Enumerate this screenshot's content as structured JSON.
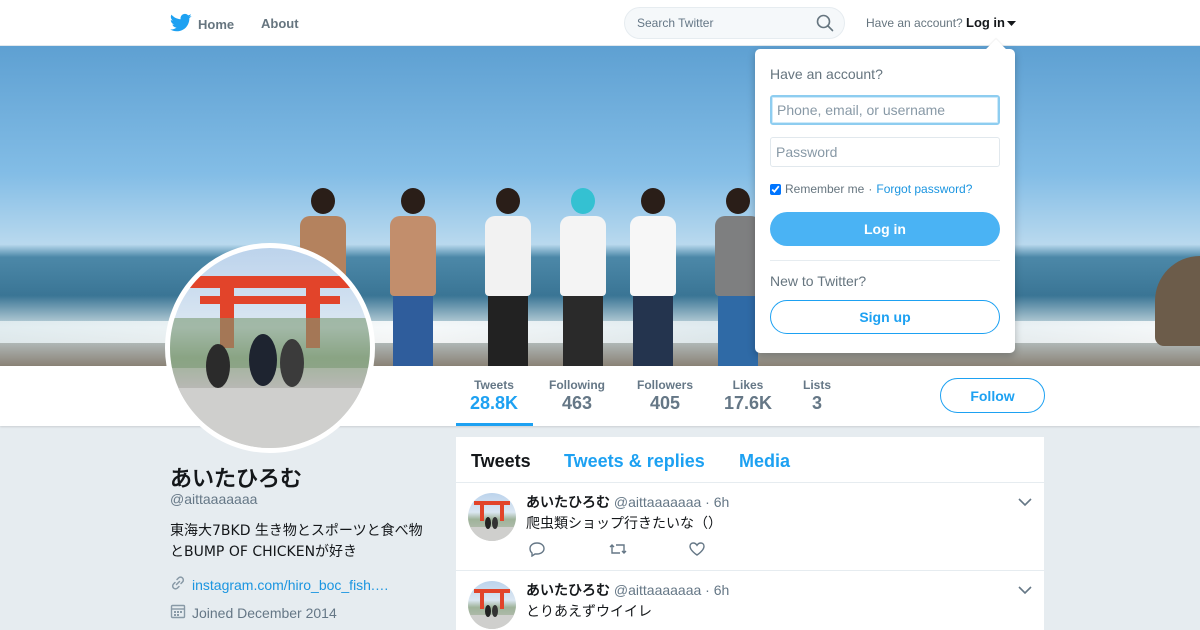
{
  "nav": {
    "home_label": "Home",
    "about_label": "About",
    "search_placeholder": "Search Twitter",
    "have_account": "Have an account?",
    "login_label": "Log in"
  },
  "profile": {
    "name": "あいたひろむ",
    "handle": "@aittaaaaaaa",
    "bio": "東海大7BKD 生き物とスポーツと食べ物とBUMP OF CHICKENが好き",
    "link": "instagram.com/hiro_boc_fish.…",
    "joined": "Joined December 2014"
  },
  "stats": [
    {
      "label": "Tweets",
      "value": "28.8K"
    },
    {
      "label": "Following",
      "value": "463"
    },
    {
      "label": "Followers",
      "value": "405"
    },
    {
      "label": "Likes",
      "value": "17.6K"
    },
    {
      "label": "Lists",
      "value": "3"
    }
  ],
  "follow_label": "Follow",
  "timeline": {
    "tabs": [
      "Tweets",
      "Tweets & replies",
      "Media"
    ],
    "tweets": [
      {
        "name": "あいたひろむ",
        "handle": "@aittaaaaaaa",
        "dot": "·",
        "time": "6h",
        "text": "爬虫類ショップ行きたいな（）"
      },
      {
        "name": "あいたひろむ",
        "handle": "@aittaaaaaaa",
        "dot": "·",
        "time": "6h",
        "text": "とりあえずウイイレ"
      }
    ]
  },
  "login_dropdown": {
    "title": "Have an account?",
    "username_placeholder": "Phone, email, or username",
    "password_placeholder": "Password",
    "remember_label": "Remember me",
    "separator": "·",
    "forgot_label": "Forgot password?",
    "login_button": "Log in",
    "new_prompt": "New to Twitter?",
    "signup_button": "Sign up"
  },
  "colors": {
    "accent": "#1da1f2",
    "login_button": "#4ab3f4",
    "background": "#e6ecf0"
  }
}
